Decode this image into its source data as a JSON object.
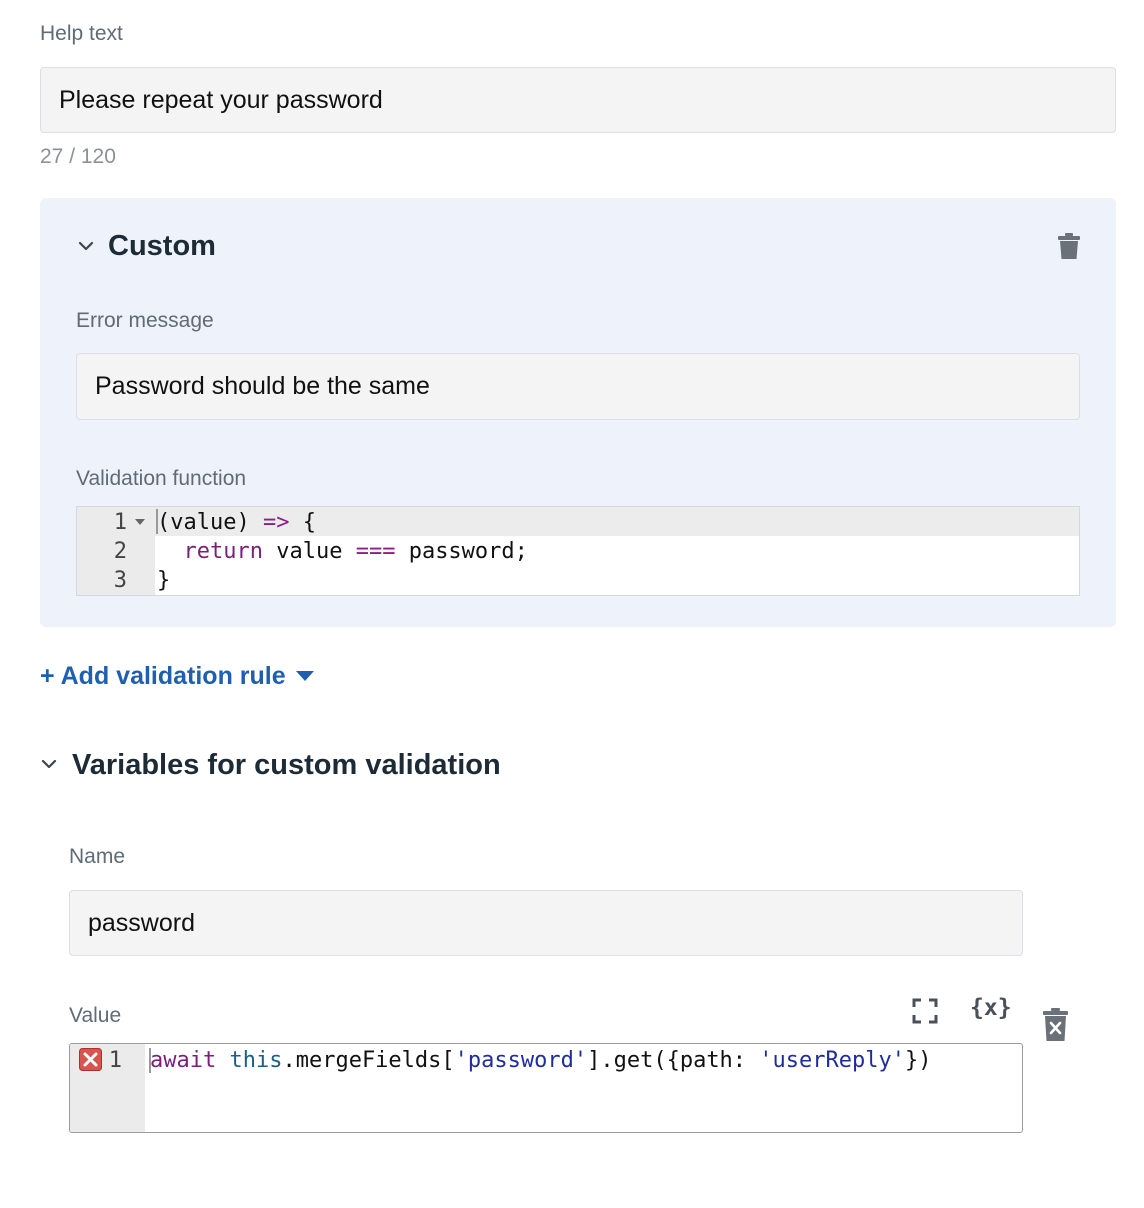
{
  "help_text": {
    "label": "Help text",
    "value": "Please repeat your password",
    "counter": "27 / 120"
  },
  "custom_rule": {
    "title": "Custom",
    "error_message_label": "Error message",
    "error_message_value": "Password should be the same",
    "validation_function_label": "Validation function",
    "code_lines": [
      {
        "num": "1"
      },
      {
        "num": "2"
      },
      {
        "num": "3"
      }
    ],
    "code": {
      "l1_a": "(value) ",
      "l1_op": "=>",
      "l1_b": " {",
      "l2_indent": "  ",
      "l2_kw": "return",
      "l2_a": " value ",
      "l2_op": "===",
      "l2_b": " password;",
      "l3": "}"
    }
  },
  "add_rule": {
    "label": "+ Add validation rule"
  },
  "variables": {
    "title": "Variables for custom validation",
    "name_label": "Name",
    "name_value": "password",
    "value_label": "Value",
    "variable_button_label": "{x}",
    "value_line_num": "1",
    "value_code": {
      "kw": "await",
      "sp": " ",
      "this": "this",
      "a": ".mergeFields[",
      "s1": "'password'",
      "b": "].get({path: ",
      "s2": "'userReply'",
      "c": "})"
    }
  },
  "colors": {
    "accent": "#1f5fb0",
    "panel_bg": "#eef2fa",
    "error": "#d9534f"
  }
}
